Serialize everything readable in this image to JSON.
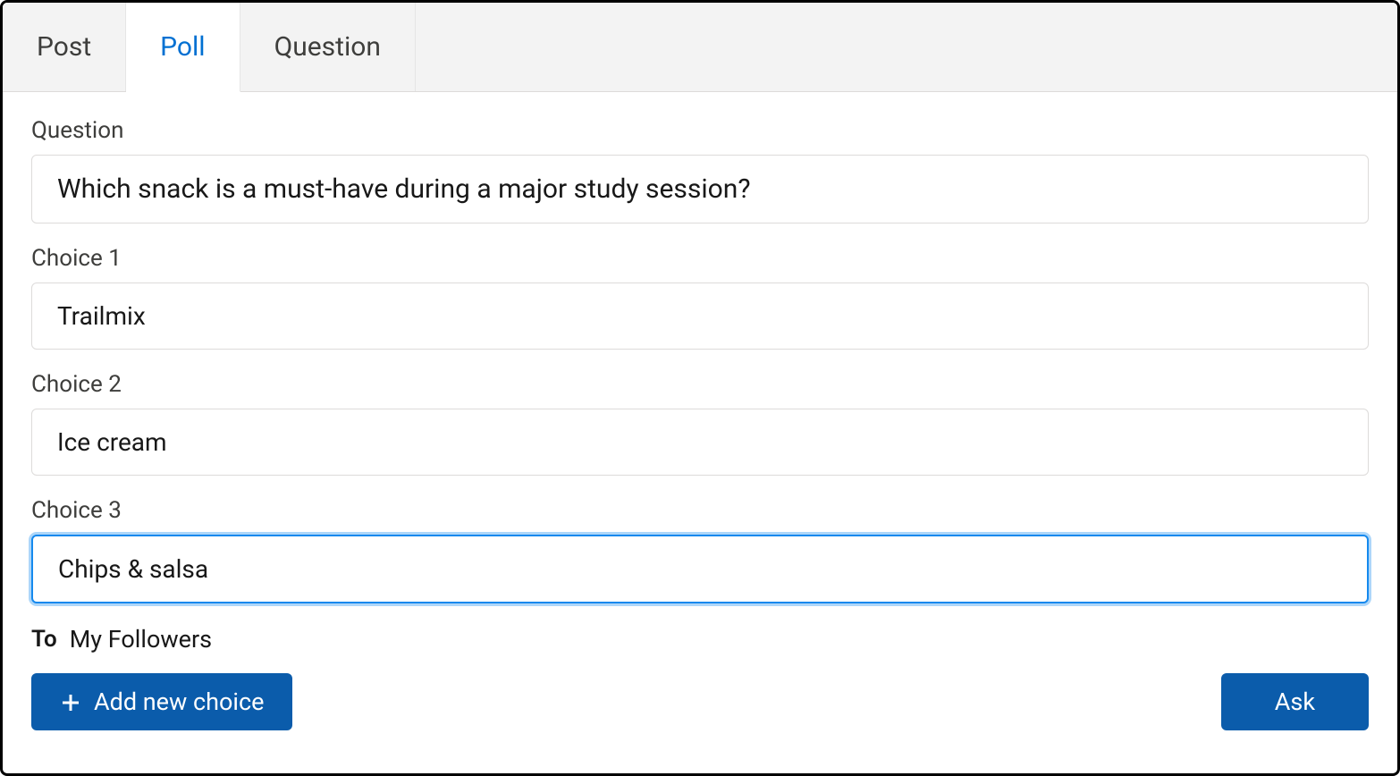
{
  "tabs": {
    "post": "Post",
    "poll": "Poll",
    "question": "Question"
  },
  "form": {
    "questionLabel": "Question",
    "questionValue": "Which snack is a must-have during a major study session?",
    "choices": [
      {
        "label": "Choice 1",
        "value": "Trailmix"
      },
      {
        "label": "Choice 2",
        "value": "Ice cream"
      },
      {
        "label": "Choice 3",
        "value": "Chips & salsa"
      }
    ],
    "toLabel": "To",
    "toValue": "My Followers"
  },
  "buttons": {
    "addChoice": "Add new choice",
    "ask": "Ask"
  }
}
